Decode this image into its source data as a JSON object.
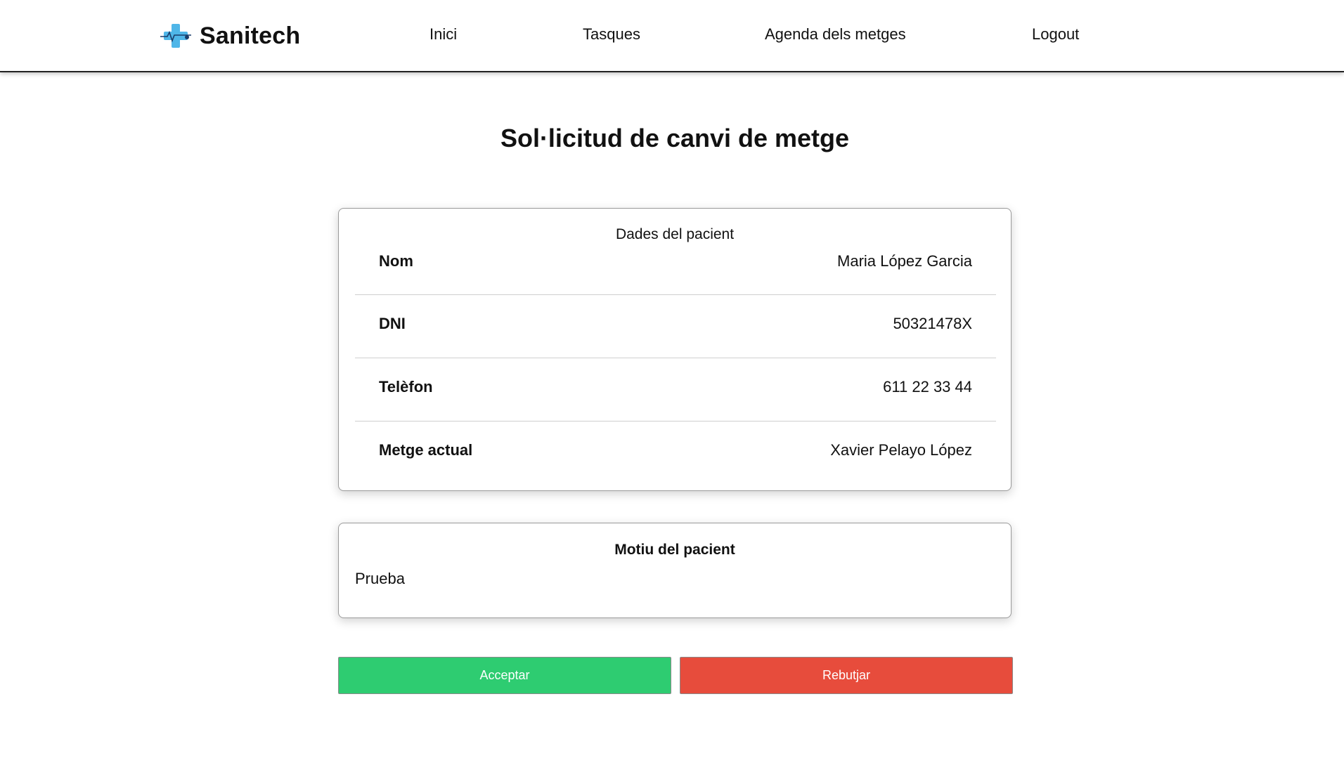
{
  "colors": {
    "accept": "#2ecc71",
    "reject": "#e74c3c",
    "logo_cross": "#4fb6e8",
    "logo_dark": "#1a3d6b"
  },
  "nav": {
    "brand": "Sanitech",
    "links": [
      "Inici",
      "Tasques",
      "Agenda dels metges",
      "Logout"
    ]
  },
  "page": {
    "title": "Sol·licitud de canvi de metge"
  },
  "patient": {
    "header": "Dades del pacient",
    "rows": [
      {
        "label": "Nom",
        "value": "Maria López Garcia"
      },
      {
        "label": "DNI",
        "value": "50321478X"
      },
      {
        "label": "Telèfon",
        "value": "611 22 33 44"
      },
      {
        "label": "Metge actual",
        "value": "Xavier Pelayo López"
      }
    ]
  },
  "reason": {
    "title": "Motiu del pacient",
    "text": "Prueba"
  },
  "actions": {
    "accept": "Acceptar",
    "reject": "Rebutjar"
  }
}
